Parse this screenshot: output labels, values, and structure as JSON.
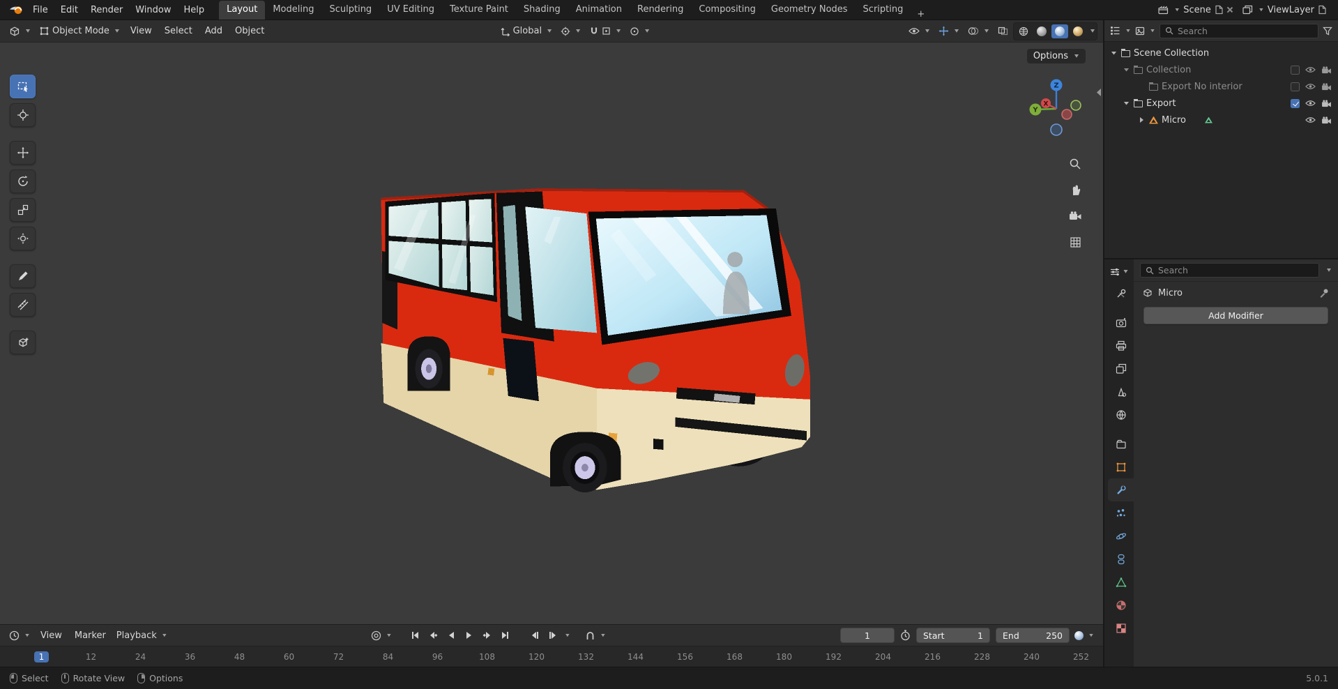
{
  "colors": {
    "accent_blue": "#4772b3",
    "viewport_bg": "#3b3b3b",
    "bus_red": "#d92a10",
    "bus_cream": "#e6d5a9",
    "glass_blue": "#bfe7f6"
  },
  "icons": {
    "blender-logo": "orange-dot-swoosh",
    "search-icon": "magnifier",
    "filter-icon": "funnel",
    "eye-icon": "eye",
    "camera-icon": "camera",
    "magnet-icon": "magnet",
    "collection-icon": "open-box",
    "mesh-object-icon": "orange-triangle",
    "mesh-data-icon": "green-triangle",
    "play-icon": "triangle-right",
    "wrench-icon": "wrench",
    "pin-icon": "pushpin",
    "mouse-left-icon": "lmb",
    "mouse-middle-icon": "mmb",
    "mouse-right-icon": "rmb"
  },
  "topbar": {
    "menus": [
      {
        "label": "File"
      },
      {
        "label": "Edit"
      },
      {
        "label": "Render"
      },
      {
        "label": "Window"
      },
      {
        "label": "Help"
      }
    ],
    "workspaces": [
      {
        "label": "Layout",
        "active": true
      },
      {
        "label": "Modeling"
      },
      {
        "label": "Sculpting"
      },
      {
        "label": "UV Editing"
      },
      {
        "label": "Texture Paint"
      },
      {
        "label": "Shading"
      },
      {
        "label": "Animation"
      },
      {
        "label": "Rendering"
      },
      {
        "label": "Compositing"
      },
      {
        "label": "Geometry Nodes"
      },
      {
        "label": "Scripting"
      }
    ],
    "add_workspace": "+",
    "scene": {
      "label": "Scene"
    },
    "view_layer": {
      "label": "ViewLayer"
    }
  },
  "viewport_header": {
    "mode": "Object Mode",
    "menus": [
      {
        "label": "View"
      },
      {
        "label": "Select"
      },
      {
        "label": "Add"
      },
      {
        "label": "Object"
      }
    ],
    "orientation": "Global"
  },
  "viewport": {
    "options_button": "Options",
    "gizmo": {
      "x": "X",
      "y": "Y",
      "z": "Z"
    }
  },
  "outliner": {
    "search_placeholder": "Search",
    "rows": [
      {
        "label": "Scene Collection",
        "indent": 0
      },
      {
        "label": "Collection",
        "indent": 1,
        "dimmed": true
      },
      {
        "label": "Export No interior",
        "indent": 2,
        "dimmed": true
      },
      {
        "label": "Export",
        "indent": 1,
        "checked": true
      },
      {
        "label": "Micro",
        "indent": 2
      }
    ]
  },
  "properties": {
    "search_placeholder": "Search",
    "breadcrumb": "Micro",
    "add_modifier_button": "Add Modifier"
  },
  "timeline": {
    "menus": [
      {
        "label": "View"
      },
      {
        "label": "Marker"
      },
      {
        "label": "Playback"
      }
    ],
    "current_frame": "1",
    "start_label": "Start",
    "start_value": "1",
    "end_label": "End",
    "end_value": "250",
    "frames": [
      "1",
      "12",
      "24",
      "36",
      "48",
      "60",
      "72",
      "84",
      "96",
      "108",
      "120",
      "132",
      "144",
      "156",
      "168",
      "180",
      "192",
      "204",
      "216",
      "228",
      "240",
      "252"
    ]
  },
  "statusbar": {
    "items": [
      {
        "label": "Select"
      },
      {
        "label": "Rotate View"
      },
      {
        "label": "Options"
      }
    ],
    "version": "5.0.1"
  }
}
